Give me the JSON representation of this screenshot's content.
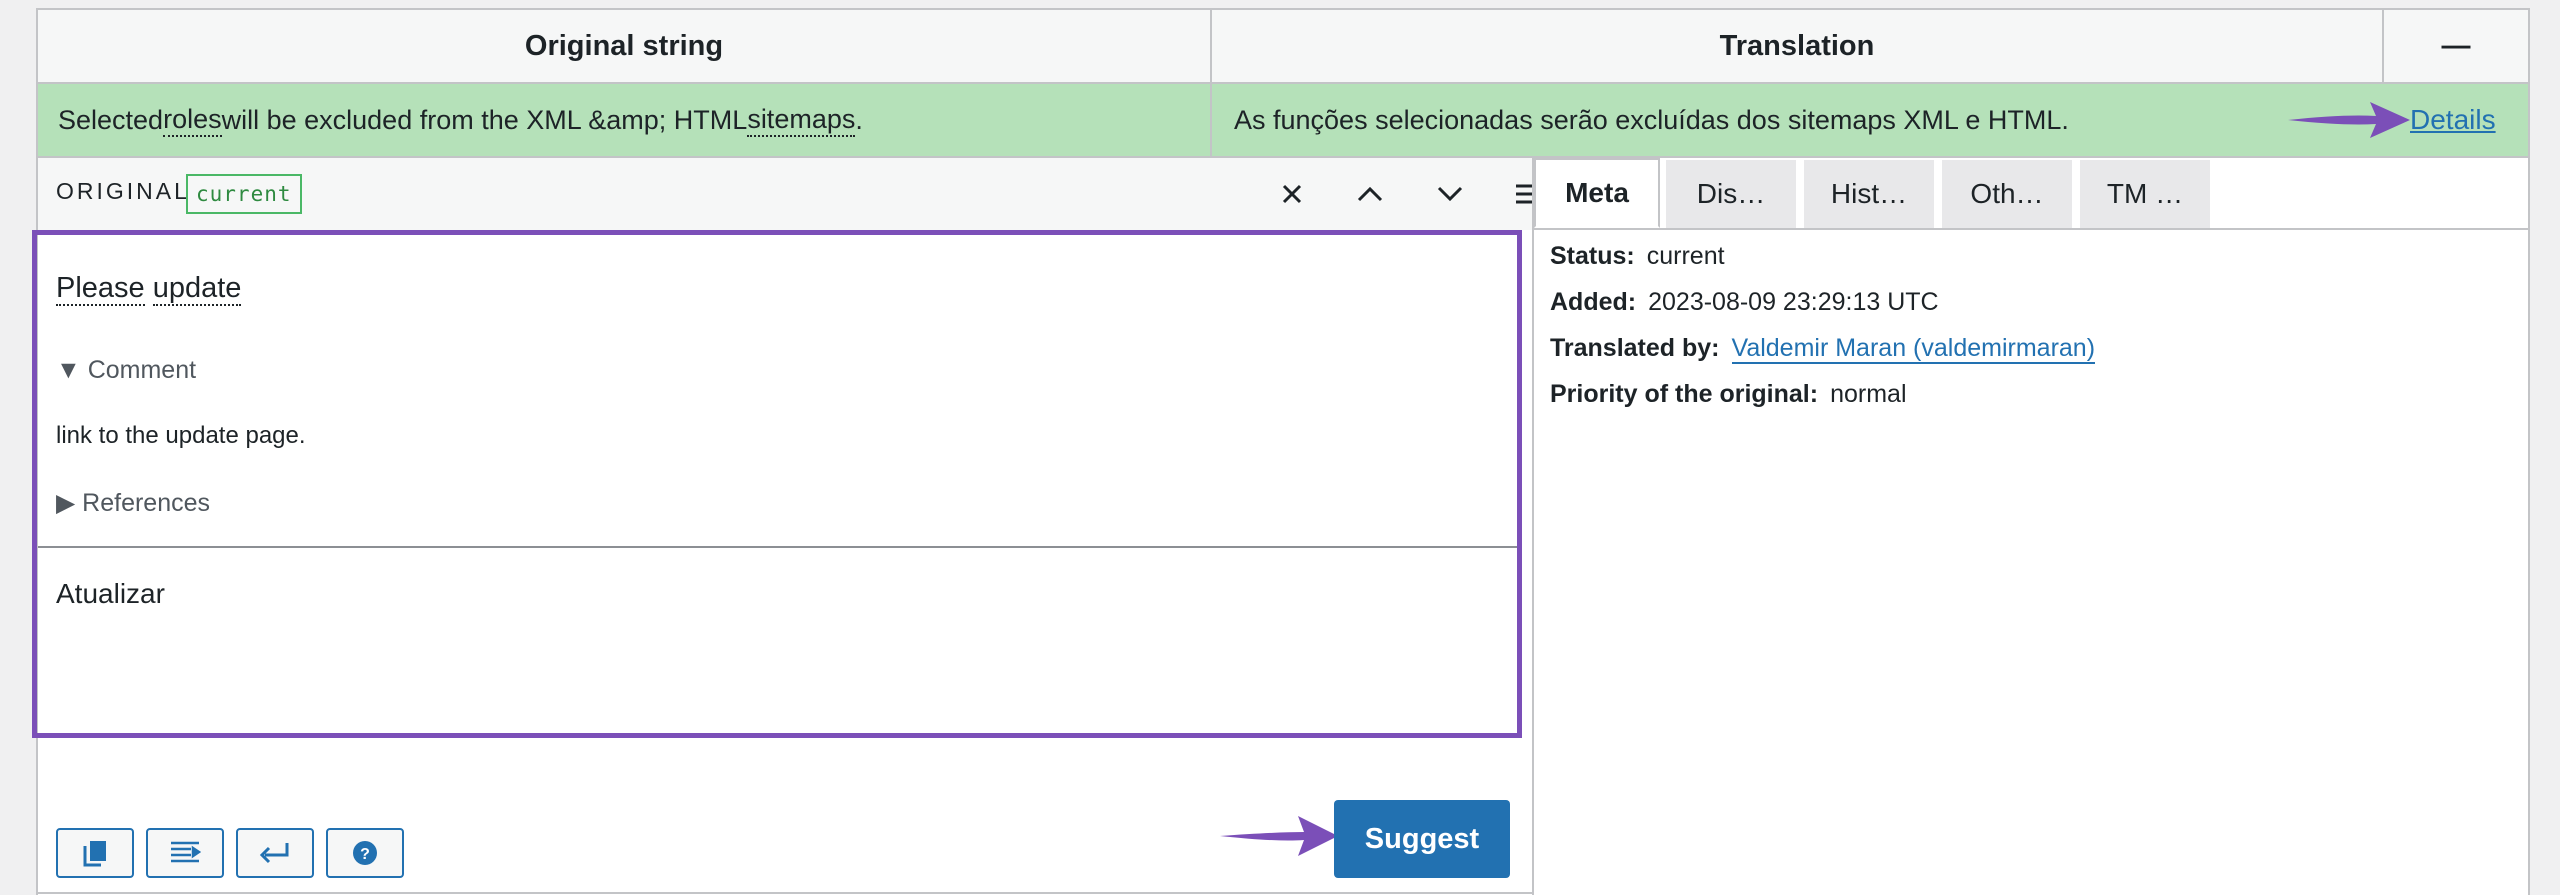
{
  "header": {
    "original_col": "Original string",
    "translation_col": "Translation",
    "collapse_symbol": "—"
  },
  "row": {
    "original_parts": [
      "Selected ",
      "roles",
      " will be excluded from the XML &amp; HTML ",
      "sitemaps",
      "."
    ],
    "translation": "As funções selecionadas serão excluídas dos sitemaps XML e HTML.",
    "details_link": "Details"
  },
  "editor": {
    "original_label": "ORIGINAL",
    "status_badge": "current",
    "original_words": [
      "Please",
      "update"
    ],
    "comment_toggle": "▼ Comment",
    "comment_text": "link to the update page.",
    "references_toggle": "▶ References",
    "translation_value": "Atualizar",
    "suggest_button": "Suggest"
  },
  "meta": {
    "tabs": [
      "Meta",
      "Dis…",
      "Hist…",
      "Oth…",
      "TM …"
    ],
    "status_label": "Status:",
    "status_value": "current",
    "added_label": "Added:",
    "added_value": "2023-08-09 23:29:13 UTC",
    "translated_by_label": "Translated by:",
    "translated_by_value": "Valdemir Maran (valdemirmaran)",
    "priority_label": "Priority of the original:",
    "priority_value": "normal"
  },
  "colors": {
    "accent": "#2271b1",
    "highlight_row": "#b5e1b9",
    "annotation": "#7b4fb8",
    "badge": "#4ab866"
  },
  "icons": [
    "close-icon",
    "chevron-up-icon",
    "chevron-down-icon",
    "menu-icon",
    "copy-icon",
    "insert-tab-icon",
    "newline-icon",
    "help-icon",
    "arrow-annotation-icon"
  ]
}
